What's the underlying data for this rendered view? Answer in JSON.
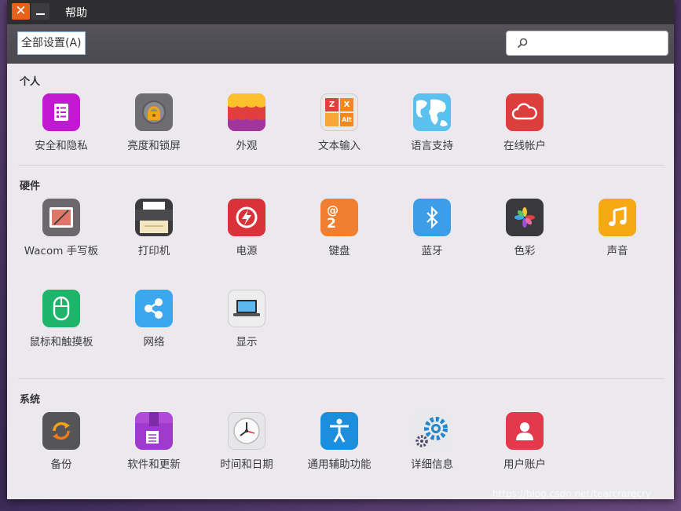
{
  "window": {
    "title": "帮助"
  },
  "toolbar": {
    "all_settings_label": "全部设置(A)",
    "search_placeholder": ""
  },
  "sections": {
    "personal": {
      "title": "个人",
      "items": [
        "安全和隐私",
        "亮度和锁屏",
        "外观",
        "文本输入",
        "语言支持",
        "在线帐户"
      ]
    },
    "hardware": {
      "title": "硬件",
      "items": [
        "Wacom 手写板",
        "打印机",
        "电源",
        "键盘",
        "蓝牙",
        "色彩",
        "声音",
        "鼠标和触摸板",
        "网络",
        "显示"
      ]
    },
    "system": {
      "title": "系统",
      "items": [
        "备份",
        "软件和更新",
        "时间和日期",
        "通用辅助功能",
        "详细信息",
        "用户账户"
      ]
    }
  },
  "icon_glyphs": {
    "keyboard_at": "@",
    "keyboard_two": "2",
    "text_input_keys": [
      "Z",
      "X",
      "Alt"
    ]
  },
  "colors": {
    "close_button": "#e8601e",
    "titlebar": "#2e2d30",
    "toolbar": "#4f4d54",
    "window_bg": "#ebe9ee"
  },
  "watermark": "https://blog.csdn.net/tearcrarecry"
}
